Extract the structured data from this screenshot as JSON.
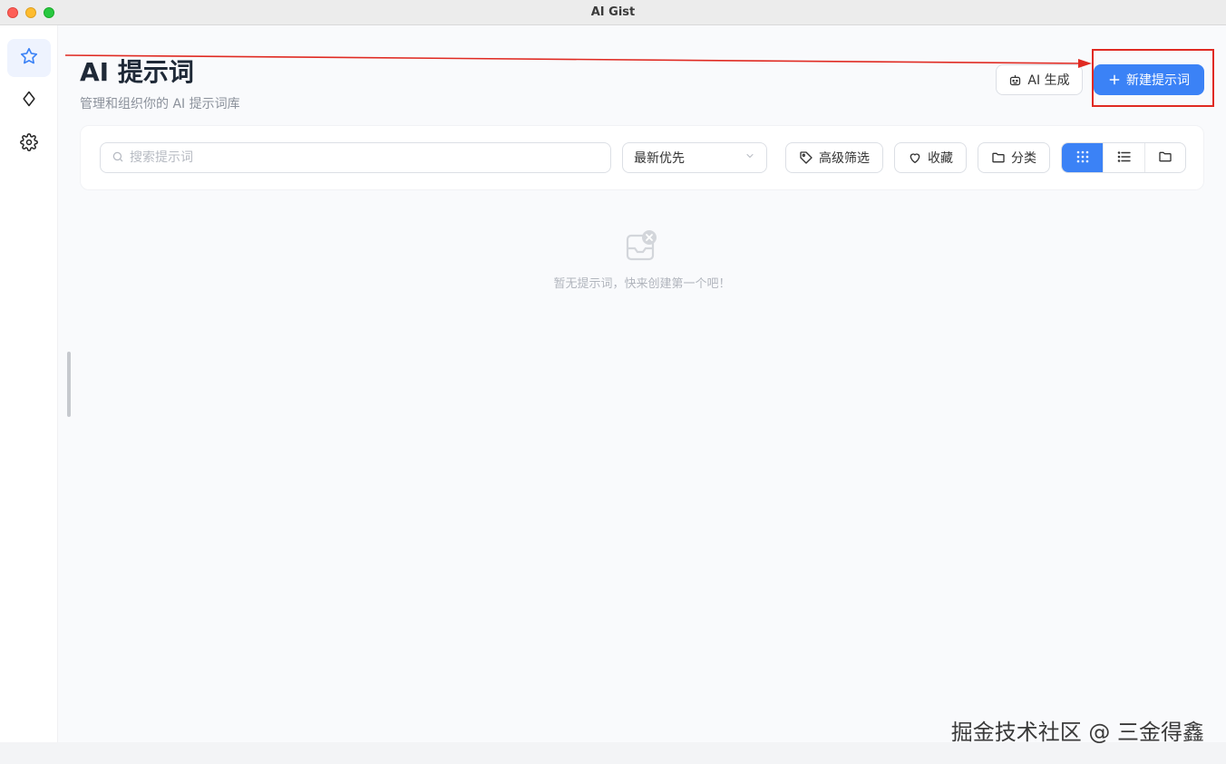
{
  "window": {
    "title": "AI Gist"
  },
  "sidebar": {
    "items": [
      {
        "name": "prompts",
        "icon": "star-icon",
        "active": true
      },
      {
        "name": "diamond",
        "icon": "diamond-icon",
        "active": false
      },
      {
        "name": "settings",
        "icon": "gear-icon",
        "active": false
      }
    ]
  },
  "header": {
    "title": "AI 提示词",
    "subtitle": "管理和组织你的 AI 提示词库",
    "ai_button_label": "AI 生成",
    "new_button_label": "新建提示词"
  },
  "toolbar": {
    "search_placeholder": "搜索提示词",
    "sort_value": "最新优先",
    "advanced_filter_label": "高级筛选",
    "favorites_label": "收藏",
    "category_label": "分类",
    "view_modes": [
      "grid",
      "list",
      "folder"
    ],
    "active_view": "grid"
  },
  "empty_state": {
    "text": "暂无提示词，快来创建第一个吧！"
  },
  "watermark": "掘金技术社区 @ 三金得鑫",
  "colors": {
    "accent": "#3b82f6",
    "annotation": "#e02a22"
  }
}
